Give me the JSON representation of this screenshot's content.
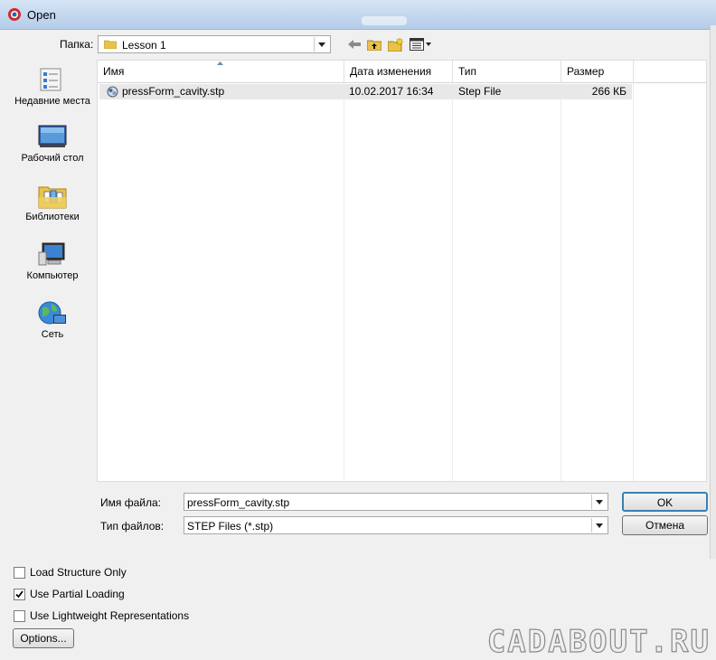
{
  "window": {
    "title": "Open"
  },
  "lookin": {
    "label": "Папка:",
    "value": "Lesson 1"
  },
  "places": [
    {
      "label": "Недавние места",
      "icon": "recent-places-icon"
    },
    {
      "label": "Рабочий стол",
      "icon": "desktop-icon"
    },
    {
      "label": "Библиотеки",
      "icon": "libraries-icon"
    },
    {
      "label": "Компьютер",
      "icon": "computer-icon"
    },
    {
      "label": "Сеть",
      "icon": "network-icon"
    }
  ],
  "filelist": {
    "columns": [
      "Имя",
      "Дата изменения",
      "Тип",
      "Размер"
    ],
    "rows": [
      {
        "name": "pressForm_cavity.stp",
        "modified": "10.02.2017 16:34",
        "type": "Step File",
        "size": "266 КБ",
        "icon": "step-file-icon"
      }
    ]
  },
  "filename": {
    "label": "Имя файла:",
    "value": "pressForm_cavity.stp"
  },
  "filetype": {
    "label": "Тип файлов:",
    "value": "STEP Files (*.stp)"
  },
  "buttons": {
    "ok": "OK",
    "cancel": "Отмена",
    "options": "Options..."
  },
  "options": [
    {
      "label": "Load Structure Only",
      "checked": false
    },
    {
      "label": "Use Partial Loading",
      "checked": true
    },
    {
      "label": "Use Lightweight Representations",
      "checked": false
    }
  ],
  "watermark": "CADABOUT.RU",
  "colors": {
    "titlebar": "#c4d8ef",
    "selection": "#e8e8e8",
    "folder": "#e8c24a"
  }
}
